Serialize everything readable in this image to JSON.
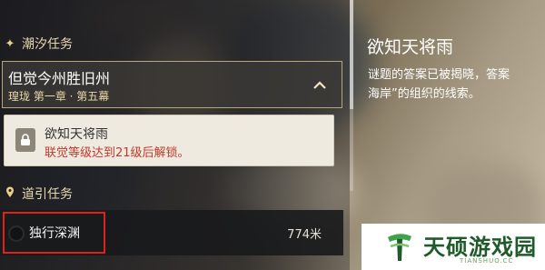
{
  "sections": {
    "tidal_title": "潮汐任务",
    "guide_title": "道引任务"
  },
  "icons": {
    "tidal_icon": "sparkle-icon",
    "guide_icon": "location-pin-icon",
    "collapse_icon": "chevron-up-icon",
    "lock_icon": "lock-icon"
  },
  "quest_group": {
    "name": "但觉今州胜旧州",
    "chapter": "瑝珑 第一章 · 第五幕"
  },
  "locked_quest": {
    "name": "欲知天将雨",
    "requirement": "联觉等级达到21级后解锁。"
  },
  "guide_quest": {
    "name": "独行深渊",
    "distance": "774米"
  },
  "detail": {
    "title": "欲知天将雨",
    "description": "谜题的答案已被揭晓，答案\n海岸”的组织的线索。"
  },
  "watermark": {
    "name": "天硕游戏园",
    "sub": "TIANSHUO.CC"
  },
  "colors": {
    "accent": "#e8d9b0",
    "warning": "#c0392b",
    "highlight": "#e0221f",
    "watermark_green": "#1f5b2a"
  }
}
